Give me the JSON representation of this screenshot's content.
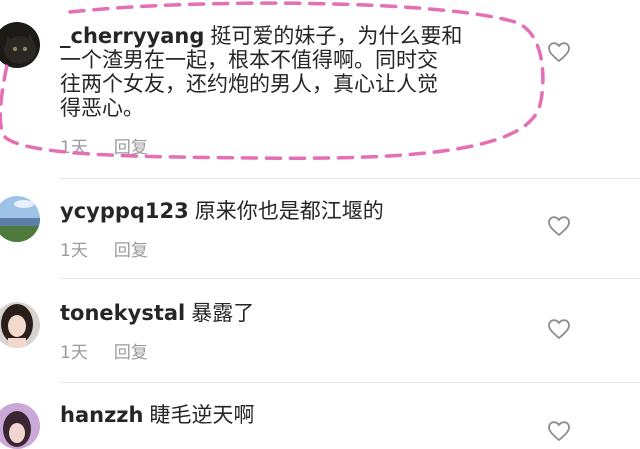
{
  "comments": [
    {
      "username": "_cherryyang",
      "lines": [
        "挺可爱的妹子，为什么要和",
        "一个渣男在一起，根本不值得啊。同时交",
        "往两个女友，还约炮的男人，真心让人觉",
        "得恶心。"
      ],
      "time": "1天",
      "reply": "回复"
    },
    {
      "username": "ycyppq123",
      "text": "原来你也是都江堰的",
      "time": "1天",
      "reply": "回复"
    },
    {
      "username": "tonekystal",
      "text": "暴露了",
      "time": "1天",
      "reply": "回复"
    },
    {
      "username": "hanzzh",
      "text": "睫毛逆天啊"
    }
  ],
  "colors": {
    "highlight": "#e46fb4",
    "muted": "#9a9a9a",
    "text": "#262626"
  },
  "icons": [
    "heart-icon"
  ]
}
